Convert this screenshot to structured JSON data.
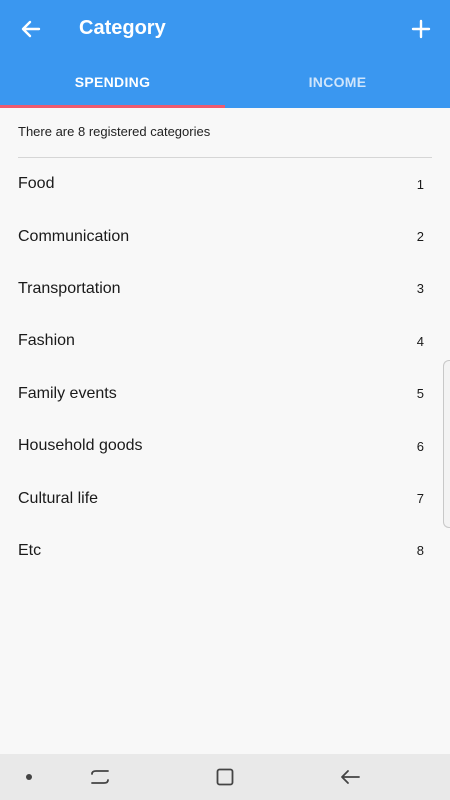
{
  "header": {
    "title": "Category",
    "back_icon": "arrow-left-icon",
    "add_icon": "plus-icon",
    "background_color": "#3a97f0"
  },
  "tabs": [
    {
      "label": "SPENDING",
      "active": true
    },
    {
      "label": "INCOME",
      "active": false
    }
  ],
  "indicator_color": "#ee5a6f",
  "summary": "There are 8 registered categories",
  "categories": [
    {
      "name": "Food",
      "number": "1"
    },
    {
      "name": "Communication",
      "number": "2"
    },
    {
      "name": "Transportation",
      "number": "3"
    },
    {
      "name": "Fashion",
      "number": "4"
    },
    {
      "name": "Family events",
      "number": "5"
    },
    {
      "name": "Household goods",
      "number": "6"
    },
    {
      "name": "Cultural life",
      "number": "7"
    },
    {
      "name": "Etc",
      "number": "8"
    }
  ],
  "system_nav": {
    "icons": [
      "dot-icon",
      "recent-apps-icon",
      "home-icon",
      "back-icon"
    ]
  }
}
